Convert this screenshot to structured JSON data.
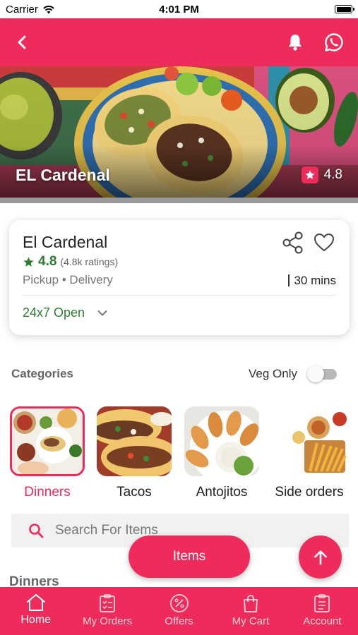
{
  "status_bar": {
    "carrier": "Carrier",
    "time": "4:01 PM"
  },
  "app_bar": {
    "back_icon": "chevron-left-icon",
    "notification_icon": "bell-icon",
    "whatsapp_icon": "whatsapp-icon"
  },
  "hero": {
    "title": "EL Cardenal",
    "rating": "4.8"
  },
  "restaurant": {
    "name": "El Cardenal",
    "rating": "4.8",
    "ratings_count": "(4.8k ratings)",
    "services": "Pickup • Delivery",
    "delivery_time": "30 mins",
    "open_status": "24x7 Open"
  },
  "categories": {
    "title": "Categories",
    "veg_only_label": "Veg Only",
    "veg_only_on": false,
    "items": [
      {
        "label": "Dinners",
        "active": true
      },
      {
        "label": "Tacos",
        "active": false
      },
      {
        "label": "Antojitos",
        "active": false
      },
      {
        "label": "Side orders",
        "active": false
      }
    ]
  },
  "search": {
    "placeholder": "Search For Items"
  },
  "section": {
    "title": "Dinners"
  },
  "floating": {
    "items_label": "Items"
  },
  "bottom_nav": [
    {
      "label": "Home",
      "icon": "home-icon",
      "active": true
    },
    {
      "label": "My Orders",
      "icon": "orders-icon",
      "active": false
    },
    {
      "label": "Offers",
      "icon": "offers-icon",
      "active": false
    },
    {
      "label": "My Cart",
      "icon": "cart-icon",
      "active": false
    },
    {
      "label": "Account",
      "icon": "account-icon",
      "active": false
    }
  ],
  "colors": {
    "accent": "#ee2b5b",
    "rating_green": "#2e7d32"
  }
}
